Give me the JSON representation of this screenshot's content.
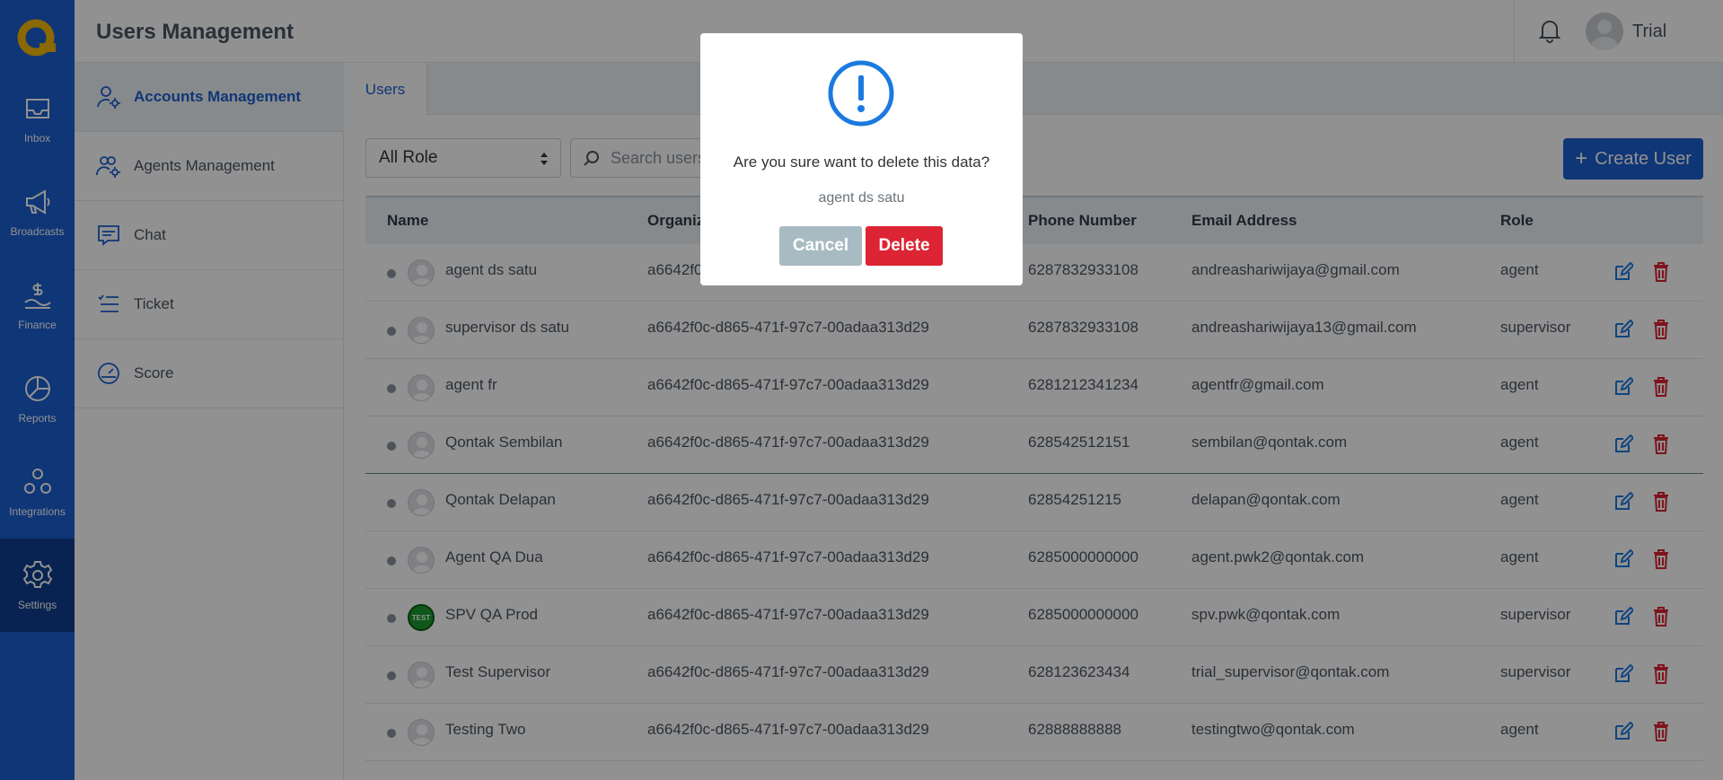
{
  "app": {
    "colors": {
      "primary": "#1b5fd0",
      "danger": "#dc2434",
      "cancel": "#a8bbc2"
    }
  },
  "leftnav": {
    "items": [
      {
        "label": "Inbox",
        "icon": "inbox-icon"
      },
      {
        "label": "Broadcasts",
        "icon": "megaphone-icon"
      },
      {
        "label": "Finance",
        "icon": "finance-icon"
      },
      {
        "label": "Reports",
        "icon": "pie-chart-icon"
      },
      {
        "label": "Integrations",
        "icon": "integrations-icon"
      },
      {
        "label": "Settings",
        "icon": "gear-icon",
        "active": true
      }
    ]
  },
  "header": {
    "title": "Users Management",
    "user_name": "Trial"
  },
  "submenu": {
    "items": [
      {
        "label": "Accounts Management",
        "icon": "user-gear-icon",
        "active": true
      },
      {
        "label": "Agents Management",
        "icon": "users-gear-icon"
      },
      {
        "label": "Chat",
        "icon": "chat-icon"
      },
      {
        "label": "Ticket",
        "icon": "ticket-list-icon"
      },
      {
        "label": "Score",
        "icon": "gauge-icon"
      }
    ]
  },
  "content": {
    "tab_label": "Users",
    "role_filter": "All Role",
    "search_placeholder": "Search users...",
    "create_label": "Create User",
    "columns": [
      "Name",
      "Organization",
      "Phone Number",
      "Email Address",
      "Role"
    ],
    "rows": [
      {
        "name": "agent ds satu",
        "org": "a6642f0c-d865-471f-97c7-00adaa313d29",
        "phone": "6287832933108",
        "email": "andreashariwijaya@gmail.com",
        "role": "agent"
      },
      {
        "name": "supervisor ds satu",
        "org": "a6642f0c-d865-471f-97c7-00adaa313d29",
        "phone": "6287832933108",
        "email": "andreashariwijaya13@gmail.com",
        "role": "supervisor"
      },
      {
        "name": "agent fr",
        "org": "a6642f0c-d865-471f-97c7-00adaa313d29",
        "phone": "6281212341234",
        "email": "agentfr@gmail.com",
        "role": "agent"
      },
      {
        "name": "Qontak Sembilan",
        "org": "a6642f0c-d865-471f-97c7-00adaa313d29",
        "phone": "628542512151",
        "email": "sembilan@qontak.com",
        "role": "agent"
      },
      {
        "name": "Qontak Delapan",
        "org": "a6642f0c-d865-471f-97c7-00adaa313d29",
        "phone": "62854251215",
        "email": "delapan@qontak.com",
        "role": "agent"
      },
      {
        "name": "Agent QA Dua",
        "org": "a6642f0c-d865-471f-97c7-00adaa313d29",
        "phone": "6285000000000",
        "email": "agent.pwk2@qontak.com",
        "role": "agent"
      },
      {
        "name": "SPV QA Prod",
        "org": "a6642f0c-d865-471f-97c7-00adaa313d29",
        "phone": "6285000000000",
        "email": "spv.pwk@qontak.com",
        "role": "supervisor",
        "avatar_text": "TEST"
      },
      {
        "name": "Test Supervisor",
        "org": "a6642f0c-d865-471f-97c7-00adaa313d29",
        "phone": "628123623434",
        "email": "trial_supervisor@qontak.com",
        "role": "supervisor"
      },
      {
        "name": "Testing Two",
        "org": "a6642f0c-d865-471f-97c7-00adaa313d29",
        "phone": "62888888888",
        "email": "testingtwo@qontak.com",
        "role": "agent"
      }
    ]
  },
  "modal": {
    "icon": "exclamation-circle-icon",
    "message": "Are you sure want to delete this data?",
    "subject": "agent ds satu",
    "cancel_label": "Cancel",
    "delete_label": "Delete"
  }
}
